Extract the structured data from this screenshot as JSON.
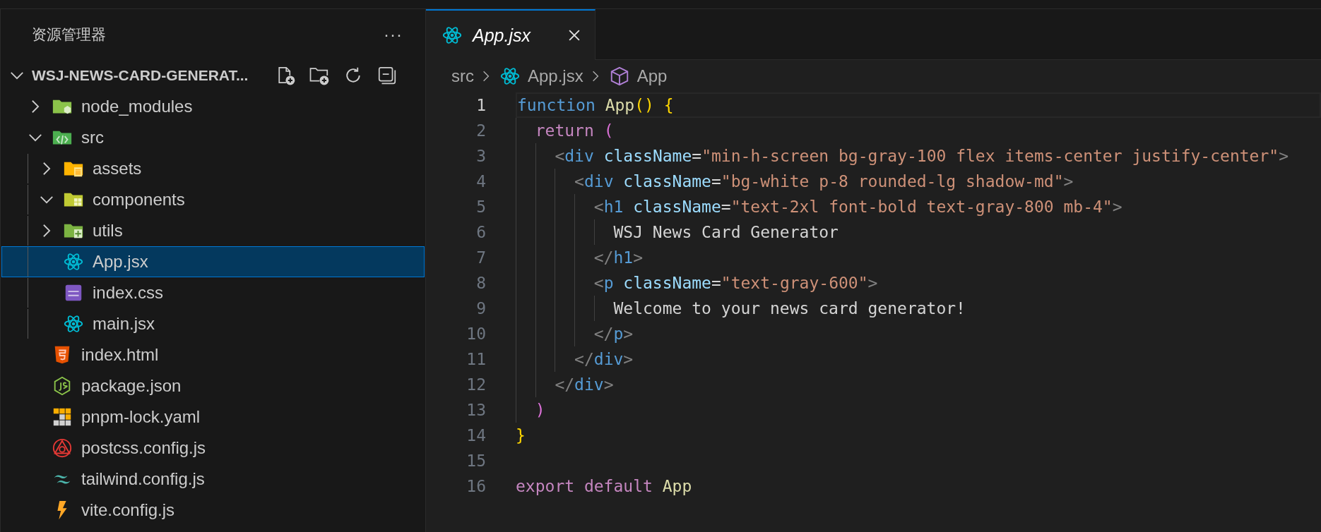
{
  "explorer": {
    "title": "资源管理器",
    "more": "···",
    "root": {
      "name": "WSJ-NEWS-CARD-GENERAT...",
      "expanded": true,
      "items": [
        {
          "name": "node_modules",
          "kind": "node",
          "expanded": false,
          "selected": false
        },
        {
          "name": "src",
          "kind": "source",
          "expanded": true,
          "selected": false,
          "children": [
            {
              "name": "assets",
              "kind": "assets",
              "expanded": false,
              "selected": false
            },
            {
              "name": "components",
              "kind": "components",
              "expanded": true,
              "selected": false
            },
            {
              "name": "utils",
              "kind": "utils",
              "expanded": false,
              "selected": false
            },
            {
              "name": "App.jsx",
              "kind": "react",
              "selected": true
            },
            {
              "name": "index.css",
              "kind": "css",
              "selected": false
            },
            {
              "name": "main.jsx",
              "kind": "react",
              "selected": false
            }
          ]
        },
        {
          "name": "index.html",
          "kind": "html",
          "selected": false
        },
        {
          "name": "package.json",
          "kind": "json",
          "selected": false
        },
        {
          "name": "pnpm-lock.yaml",
          "kind": "pnpm",
          "selected": false
        },
        {
          "name": "postcss.config.js",
          "kind": "postcss",
          "selected": false
        },
        {
          "name": "tailwind.config.js",
          "kind": "tailwind",
          "selected": false
        },
        {
          "name": "vite.config.js",
          "kind": "vite",
          "selected": false
        }
      ]
    }
  },
  "tabs": [
    {
      "label": "App.jsx",
      "kind": "react",
      "selected": true,
      "preview": true
    }
  ],
  "breadcrumb": [
    {
      "label": "src",
      "kind": "folder"
    },
    {
      "label": "App.jsx",
      "kind": "react"
    },
    {
      "label": "App",
      "kind": "symbol"
    }
  ],
  "editor": {
    "lines": [
      {
        "number": "1",
        "selected": true,
        "tokens": [
          {
            "text": "function",
            "kind": "keyword"
          },
          {
            "text": " App",
            "kind": "function"
          },
          {
            "text": "()",
            "kind": "bracket"
          },
          {
            "text": " {",
            "kind": "bracket"
          }
        ]
      },
      {
        "number": "2",
        "selected": false,
        "tokens": [
          {
            "text": "  return",
            "kind": "control"
          },
          {
            "text": " (",
            "kind": "paren"
          }
        ]
      },
      {
        "number": "3",
        "selected": false,
        "tokens": [
          {
            "text": "    <",
            "kind": "punct"
          },
          {
            "text": "div",
            "kind": "tag"
          },
          {
            "text": " className",
            "kind": "attr"
          },
          {
            "text": "=",
            "kind": "text"
          },
          {
            "text": "\"min-h-screen bg-gray-100 flex items-center justify-center\"",
            "kind": "string"
          },
          {
            "text": ">",
            "kind": "punct"
          }
        ]
      },
      {
        "number": "4",
        "selected": false,
        "tokens": [
          {
            "text": "      <",
            "kind": "punct"
          },
          {
            "text": "div",
            "kind": "tag"
          },
          {
            "text": " className",
            "kind": "attr"
          },
          {
            "text": "=",
            "kind": "text"
          },
          {
            "text": "\"bg-white p-8 rounded-lg shadow-md\"",
            "kind": "string"
          },
          {
            "text": ">",
            "kind": "punct"
          }
        ]
      },
      {
        "number": "5",
        "selected": false,
        "tokens": [
          {
            "text": "        <",
            "kind": "punct"
          },
          {
            "text": "h1",
            "kind": "tag"
          },
          {
            "text": " className",
            "kind": "attr"
          },
          {
            "text": "=",
            "kind": "text"
          },
          {
            "text": "\"text-2xl font-bold text-gray-800 mb-4\"",
            "kind": "string"
          },
          {
            "text": ">",
            "kind": "punct"
          }
        ]
      },
      {
        "number": "6",
        "selected": false,
        "tokens": [
          {
            "text": "          WSJ News Card Generator",
            "kind": "text"
          }
        ]
      },
      {
        "number": "7",
        "selected": false,
        "tokens": [
          {
            "text": "        </",
            "kind": "punct"
          },
          {
            "text": "h1",
            "kind": "tag"
          },
          {
            "text": ">",
            "kind": "punct"
          }
        ]
      },
      {
        "number": "8",
        "selected": false,
        "tokens": [
          {
            "text": "        <",
            "kind": "punct"
          },
          {
            "text": "p",
            "kind": "tag"
          },
          {
            "text": " className",
            "kind": "attr"
          },
          {
            "text": "=",
            "kind": "text"
          },
          {
            "text": "\"text-gray-600\"",
            "kind": "string"
          },
          {
            "text": ">",
            "kind": "punct"
          }
        ]
      },
      {
        "number": "9",
        "selected": false,
        "tokens": [
          {
            "text": "          Welcome to your news card generator!",
            "kind": "text"
          }
        ]
      },
      {
        "number": "10",
        "selected": false,
        "tokens": [
          {
            "text": "        </",
            "kind": "punct"
          },
          {
            "text": "p",
            "kind": "tag"
          },
          {
            "text": ">",
            "kind": "punct"
          }
        ]
      },
      {
        "number": "11",
        "selected": false,
        "tokens": [
          {
            "text": "      </",
            "kind": "punct"
          },
          {
            "text": "div",
            "kind": "tag"
          },
          {
            "text": ">",
            "kind": "punct"
          }
        ]
      },
      {
        "number": "12",
        "selected": false,
        "tokens": [
          {
            "text": "    </",
            "kind": "punct"
          },
          {
            "text": "div",
            "kind": "tag"
          },
          {
            "text": ">",
            "kind": "punct"
          }
        ]
      },
      {
        "number": "13",
        "selected": false,
        "tokens": [
          {
            "text": "  )",
            "kind": "paren"
          }
        ]
      },
      {
        "number": "14",
        "selected": false,
        "tokens": [
          {
            "text": "}",
            "kind": "bracket"
          }
        ]
      },
      {
        "number": "15",
        "selected": false
      },
      {
        "number": "16",
        "selected": false,
        "tokens": [
          {
            "text": "export default",
            "kind": "control"
          },
          {
            "text": " App",
            "kind": "function"
          }
        ]
      }
    ]
  }
}
